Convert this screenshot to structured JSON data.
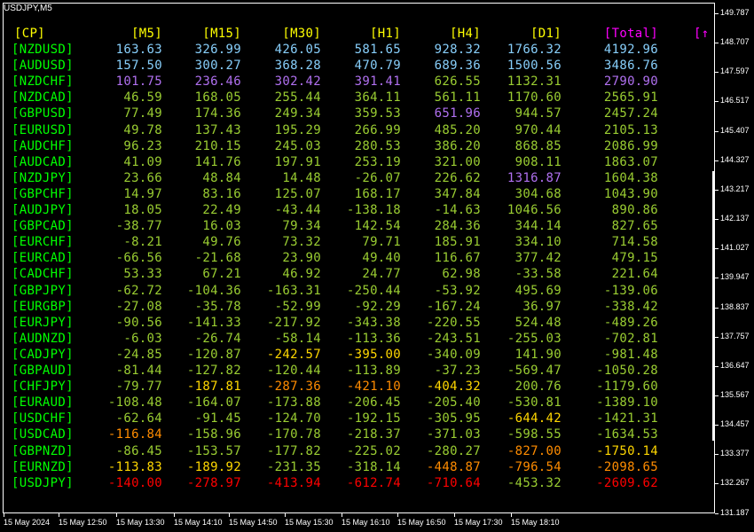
{
  "window": {
    "title": "USDJPY,M5"
  },
  "colors": {
    "header": "#ffff00",
    "total_header": "#ff00ff",
    "pair": "#00ff00",
    "positive_high": "#87cefa",
    "purple": "#b070f0",
    "positive": "#7cfc00",
    "neutral": "#9acd32",
    "warn": "#ffd700",
    "warn2": "#ff8c00",
    "negative": "#ff0000"
  },
  "table": {
    "headers": [
      "[CP]",
      "[M5]",
      "[M15]",
      "[M30]",
      "[H1]",
      "[H4]",
      "[D1]",
      "[Total]",
      "[↑"
    ],
    "rows": [
      {
        "pair": "[NZDUSD]",
        "m5": "163.63",
        "m15": "326.99",
        "m30": "426.05",
        "h1": "581.65",
        "h4": "928.32",
        "d1": "1766.32",
        "total": "4192.96",
        "c": [
          "b",
          "b",
          "b",
          "b",
          "b",
          "b",
          "b"
        ]
      },
      {
        "pair": "[AUDUSD]",
        "m5": "157.50",
        "m15": "300.27",
        "m30": "368.28",
        "h1": "470.79",
        "h4": "689.36",
        "d1": "1500.56",
        "total": "3486.76",
        "c": [
          "b",
          "b",
          "b",
          "b",
          "b",
          "b",
          "b"
        ]
      },
      {
        "pair": "[NZDCHF]",
        "m5": "101.75",
        "m15": "236.46",
        "m30": "302.42",
        "h1": "391.41",
        "h4": "626.55",
        "d1": "1132.31",
        "total": "2790.90",
        "c": [
          "p",
          "p",
          "p",
          "p",
          "g",
          "g",
          "p"
        ]
      },
      {
        "pair": "[NZDCAD]",
        "m5": "46.59",
        "m15": "168.05",
        "m30": "255.44",
        "h1": "364.11",
        "h4": "561.11",
        "d1": "1170.60",
        "total": "2565.91",
        "c": [
          "g",
          "g",
          "g",
          "g",
          "g",
          "g",
          "g"
        ]
      },
      {
        "pair": "[GBPUSD]",
        "m5": "77.49",
        "m15": "174.36",
        "m30": "249.34",
        "h1": "359.53",
        "h4": "651.96",
        "d1": "944.57",
        "total": "2457.24",
        "c": [
          "g",
          "g",
          "g",
          "g",
          "p",
          "g",
          "g"
        ]
      },
      {
        "pair": "[EURUSD]",
        "m5": "49.78",
        "m15": "137.43",
        "m30": "195.29",
        "h1": "266.99",
        "h4": "485.20",
        "d1": "970.44",
        "total": "2105.13",
        "c": [
          "g",
          "g",
          "g",
          "g",
          "g",
          "g",
          "g"
        ]
      },
      {
        "pair": "[AUDCHF]",
        "m5": "96.23",
        "m15": "210.15",
        "m30": "245.03",
        "h1": "280.53",
        "h4": "386.20",
        "d1": "868.85",
        "total": "2086.99",
        "c": [
          "g",
          "g",
          "g",
          "g",
          "g",
          "g",
          "g"
        ]
      },
      {
        "pair": "[AUDCAD]",
        "m5": "41.09",
        "m15": "141.76",
        "m30": "197.91",
        "h1": "253.19",
        "h4": "321.00",
        "d1": "908.11",
        "total": "1863.07",
        "c": [
          "g",
          "g",
          "g",
          "g",
          "g",
          "g",
          "g"
        ]
      },
      {
        "pair": "[NZDJPY]",
        "m5": "23.66",
        "m15": "48.84",
        "m30": "14.48",
        "h1": "-26.07",
        "h4": "226.62",
        "d1": "1316.87",
        "total": "1604.38",
        "c": [
          "g",
          "g",
          "g",
          "g",
          "g",
          "p",
          "g"
        ]
      },
      {
        "pair": "[GBPCHF]",
        "m5": "14.97",
        "m15": "83.16",
        "m30": "125.07",
        "h1": "168.17",
        "h4": "347.84",
        "d1": "304.68",
        "total": "1043.90",
        "c": [
          "g",
          "g",
          "g",
          "g",
          "g",
          "g",
          "g"
        ]
      },
      {
        "pair": "[AUDJPY]",
        "m5": "18.05",
        "m15": "22.49",
        "m30": "-43.44",
        "h1": "-138.18",
        "h4": "-14.63",
        "d1": "1046.56",
        "total": "890.86",
        "c": [
          "g",
          "g",
          "g",
          "g",
          "g",
          "g",
          "g"
        ]
      },
      {
        "pair": "[GBPCAD]",
        "m5": "-38.77",
        "m15": "16.03",
        "m30": "79.34",
        "h1": "142.54",
        "h4": "284.36",
        "d1": "344.14",
        "total": "827.65",
        "c": [
          "g",
          "g",
          "g",
          "g",
          "g",
          "g",
          "g"
        ]
      },
      {
        "pair": "[EURCHF]",
        "m5": "-8.21",
        "m15": "49.76",
        "m30": "73.32",
        "h1": "79.71",
        "h4": "185.91",
        "d1": "334.10",
        "total": "714.58",
        "c": [
          "g",
          "g",
          "g",
          "g",
          "g",
          "g",
          "g"
        ]
      },
      {
        "pair": "[EURCAD]",
        "m5": "-66.56",
        "m15": "-21.68",
        "m30": "23.90",
        "h1": "49.40",
        "h4": "116.67",
        "d1": "377.42",
        "total": "479.15",
        "c": [
          "g",
          "g",
          "g",
          "g",
          "g",
          "g",
          "g"
        ]
      },
      {
        "pair": "[CADCHF]",
        "m5": "53.33",
        "m15": "67.21",
        "m30": "46.92",
        "h1": "24.77",
        "h4": "62.98",
        "d1": "-33.58",
        "total": "221.64",
        "c": [
          "g",
          "g",
          "g",
          "g",
          "g",
          "g",
          "g"
        ]
      },
      {
        "pair": "[GBPJPY]",
        "m5": "-62.72",
        "m15": "-104.36",
        "m30": "-163.31",
        "h1": "-250.44",
        "h4": "-53.92",
        "d1": "495.69",
        "total": "-139.06",
        "c": [
          "g",
          "g",
          "g",
          "g",
          "g",
          "g",
          "g"
        ]
      },
      {
        "pair": "[EURGBP]",
        "m5": "-27.08",
        "m15": "-35.78",
        "m30": "-52.99",
        "h1": "-92.29",
        "h4": "-167.24",
        "d1": "36.97",
        "total": "-338.42",
        "c": [
          "g",
          "g",
          "g",
          "g",
          "g",
          "g",
          "g"
        ]
      },
      {
        "pair": "[EURJPY]",
        "m5": "-90.56",
        "m15": "-141.33",
        "m30": "-217.92",
        "h1": "-343.38",
        "h4": "-220.55",
        "d1": "524.48",
        "total": "-489.26",
        "c": [
          "g",
          "g",
          "g",
          "g",
          "g",
          "g",
          "g"
        ]
      },
      {
        "pair": "[AUDNZD]",
        "m5": "-6.03",
        "m15": "-26.74",
        "m30": "-58.14",
        "h1": "-113.36",
        "h4": "-243.51",
        "d1": "-255.03",
        "total": "-702.81",
        "c": [
          "g",
          "g",
          "g",
          "g",
          "g",
          "g",
          "g"
        ]
      },
      {
        "pair": "[CADJPY]",
        "m5": "-24.85",
        "m15": "-120.87",
        "m30": "-242.57",
        "h1": "-395.00",
        "h4": "-340.09",
        "d1": "141.90",
        "total": "-981.48",
        "c": [
          "g",
          "g",
          "y",
          "y",
          "g",
          "g",
          "g"
        ]
      },
      {
        "pair": "[GBPAUD]",
        "m5": "-81.44",
        "m15": "-127.82",
        "m30": "-120.44",
        "h1": "-113.89",
        "h4": "-37.23",
        "d1": "-569.47",
        "total": "-1050.28",
        "c": [
          "g",
          "g",
          "g",
          "g",
          "g",
          "g",
          "g"
        ]
      },
      {
        "pair": "[CHFJPY]",
        "m5": "-79.77",
        "m15": "-187.81",
        "m30": "-287.36",
        "h1": "-421.10",
        "h4": "-404.32",
        "d1": "200.76",
        "total": "-1179.60",
        "c": [
          "g",
          "y",
          "o",
          "o",
          "y",
          "g",
          "g"
        ]
      },
      {
        "pair": "[EURAUD]",
        "m5": "-108.48",
        "m15": "-164.07",
        "m30": "-173.88",
        "h1": "-206.45",
        "h4": "-205.40",
        "d1": "-530.81",
        "total": "-1389.10",
        "c": [
          "g",
          "g",
          "g",
          "g",
          "g",
          "g",
          "g"
        ]
      },
      {
        "pair": "[USDCHF]",
        "m5": "-62.64",
        "m15": "-91.45",
        "m30": "-124.70",
        "h1": "-192.15",
        "h4": "-305.95",
        "d1": "-644.42",
        "total": "-1421.31",
        "c": [
          "g",
          "g",
          "g",
          "g",
          "g",
          "y",
          "g"
        ]
      },
      {
        "pair": "[USDCAD]",
        "m5": "-116.84",
        "m15": "-158.96",
        "m30": "-170.78",
        "h1": "-218.37",
        "h4": "-371.03",
        "d1": "-598.55",
        "total": "-1634.53",
        "c": [
          "o",
          "g",
          "g",
          "g",
          "g",
          "g",
          "g"
        ]
      },
      {
        "pair": "[GBPNZD]",
        "m5": "-86.45",
        "m15": "-153.57",
        "m30": "-177.82",
        "h1": "-225.02",
        "h4": "-280.27",
        "d1": "-827.00",
        "total": "-1750.14",
        "c": [
          "g",
          "g",
          "g",
          "g",
          "g",
          "o",
          "y"
        ]
      },
      {
        "pair": "[EURNZD]",
        "m5": "-113.83",
        "m15": "-189.92",
        "m30": "-231.35",
        "h1": "-318.14",
        "h4": "-448.87",
        "d1": "-796.54",
        "total": "-2098.65",
        "c": [
          "y",
          "y",
          "g",
          "g",
          "o",
          "o",
          "o"
        ]
      },
      {
        "pair": "[USDJPY]",
        "m5": "-140.00",
        "m15": "-278.97",
        "m30": "-413.94",
        "h1": "-612.74",
        "h4": "-710.64",
        "d1": "-453.32",
        "total": "-2609.62",
        "c": [
          "r",
          "r",
          "r",
          "r",
          "r",
          "g",
          "r"
        ]
      }
    ]
  },
  "price_axis": [
    "149.787",
    "148.707",
    "147.597",
    "146.517",
    "145.407",
    "144.327",
    "143.217",
    "142.137",
    "141.027",
    "139.947",
    "138.837",
    "137.757",
    "136.647",
    "135.567",
    "134.457",
    "133.377",
    "132.267",
    "131.187"
  ],
  "time_axis": [
    "15 May 2024",
    "15 May 12:50",
    "15 May 13:30",
    "15 May 14:10",
    "15 May 14:50",
    "15 May 15:30",
    "15 May 16:10",
    "15 May 16:50",
    "15 May 17:30",
    "15 May 18:10"
  ]
}
